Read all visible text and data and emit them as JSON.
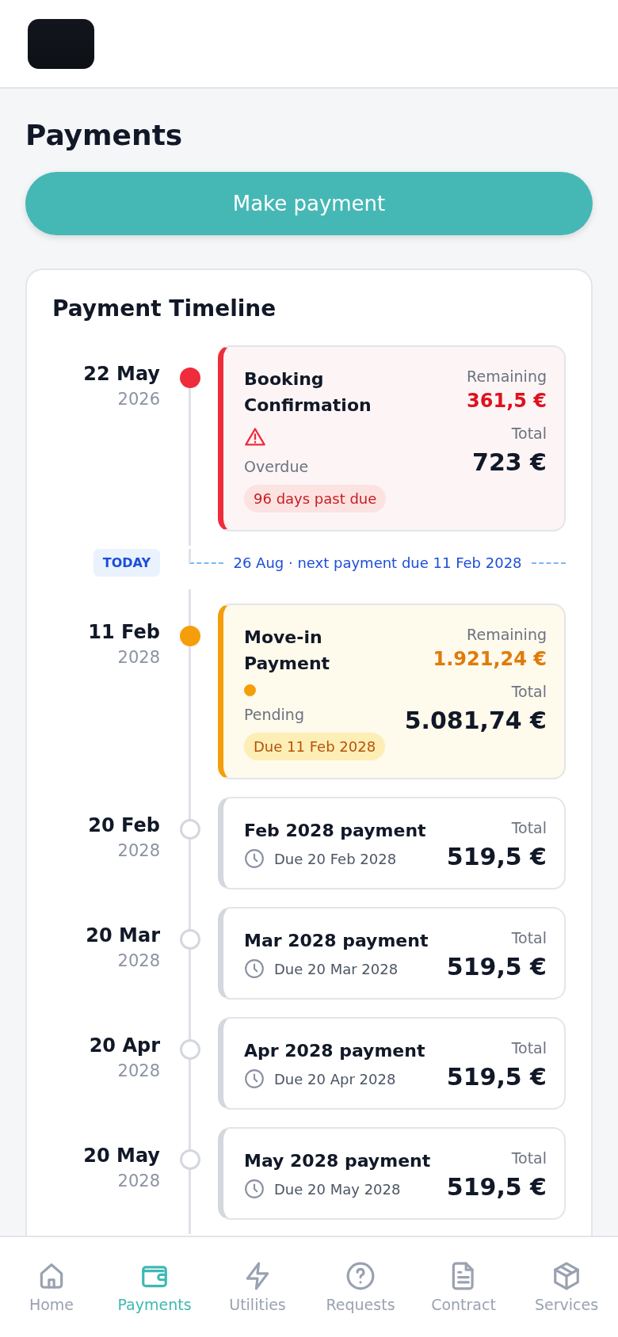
{
  "page_title": "Payments",
  "make_payment": "Make payment",
  "timeline": {
    "title": "Payment Timeline",
    "items": [
      {
        "kind": "overdue",
        "day": "22 May",
        "year": "2026",
        "title": "Booking Confirmation",
        "status": "Overdue",
        "badge": "96 days past due",
        "remaining_label": "Remaining",
        "remaining": "361,5 €",
        "total_label": "Total",
        "total": "723 €"
      },
      {
        "kind": "today",
        "label": "TODAY",
        "text": "26 Aug · next payment due 11 Feb 2028"
      },
      {
        "kind": "pending",
        "day": "11 Feb",
        "year": "2028",
        "title": "Move-in Payment",
        "status": "Pending",
        "badge": "Due 11 Feb 2028",
        "remaining_label": "Remaining",
        "remaining": "1.921,24 €",
        "total_label": "Total",
        "total": "5.081,74 €"
      },
      {
        "kind": "scheduled",
        "day": "20 Feb",
        "year": "2028",
        "title": "Feb 2028 payment",
        "due": "Due 20 Feb 2028",
        "total_label": "Total",
        "total": "519,5 €"
      },
      {
        "kind": "scheduled",
        "day": "20 Mar",
        "year": "2028",
        "title": "Mar 2028 payment",
        "due": "Due 20 Mar 2028",
        "total_label": "Total",
        "total": "519,5 €"
      },
      {
        "kind": "scheduled",
        "day": "20 Apr",
        "year": "2028",
        "title": "Apr 2028 payment",
        "due": "Due 20 Apr 2028",
        "total_label": "Total",
        "total": "519,5 €"
      },
      {
        "kind": "scheduled",
        "day": "20 May",
        "year": "2028",
        "title": "May 2028 payment",
        "due": "Due 20 May 2028",
        "total_label": "Total",
        "total": "519,5 €"
      }
    ]
  },
  "nav": [
    {
      "label": "Home",
      "kind": "home",
      "selected": false
    },
    {
      "label": "Payments",
      "kind": "wallet",
      "selected": true
    },
    {
      "label": "Utilities",
      "kind": "bolt",
      "selected": false
    },
    {
      "label": "Requests",
      "kind": "help",
      "selected": false
    },
    {
      "label": "Contract",
      "kind": "document",
      "selected": false
    },
    {
      "label": "Services",
      "kind": "box",
      "selected": false
    }
  ]
}
